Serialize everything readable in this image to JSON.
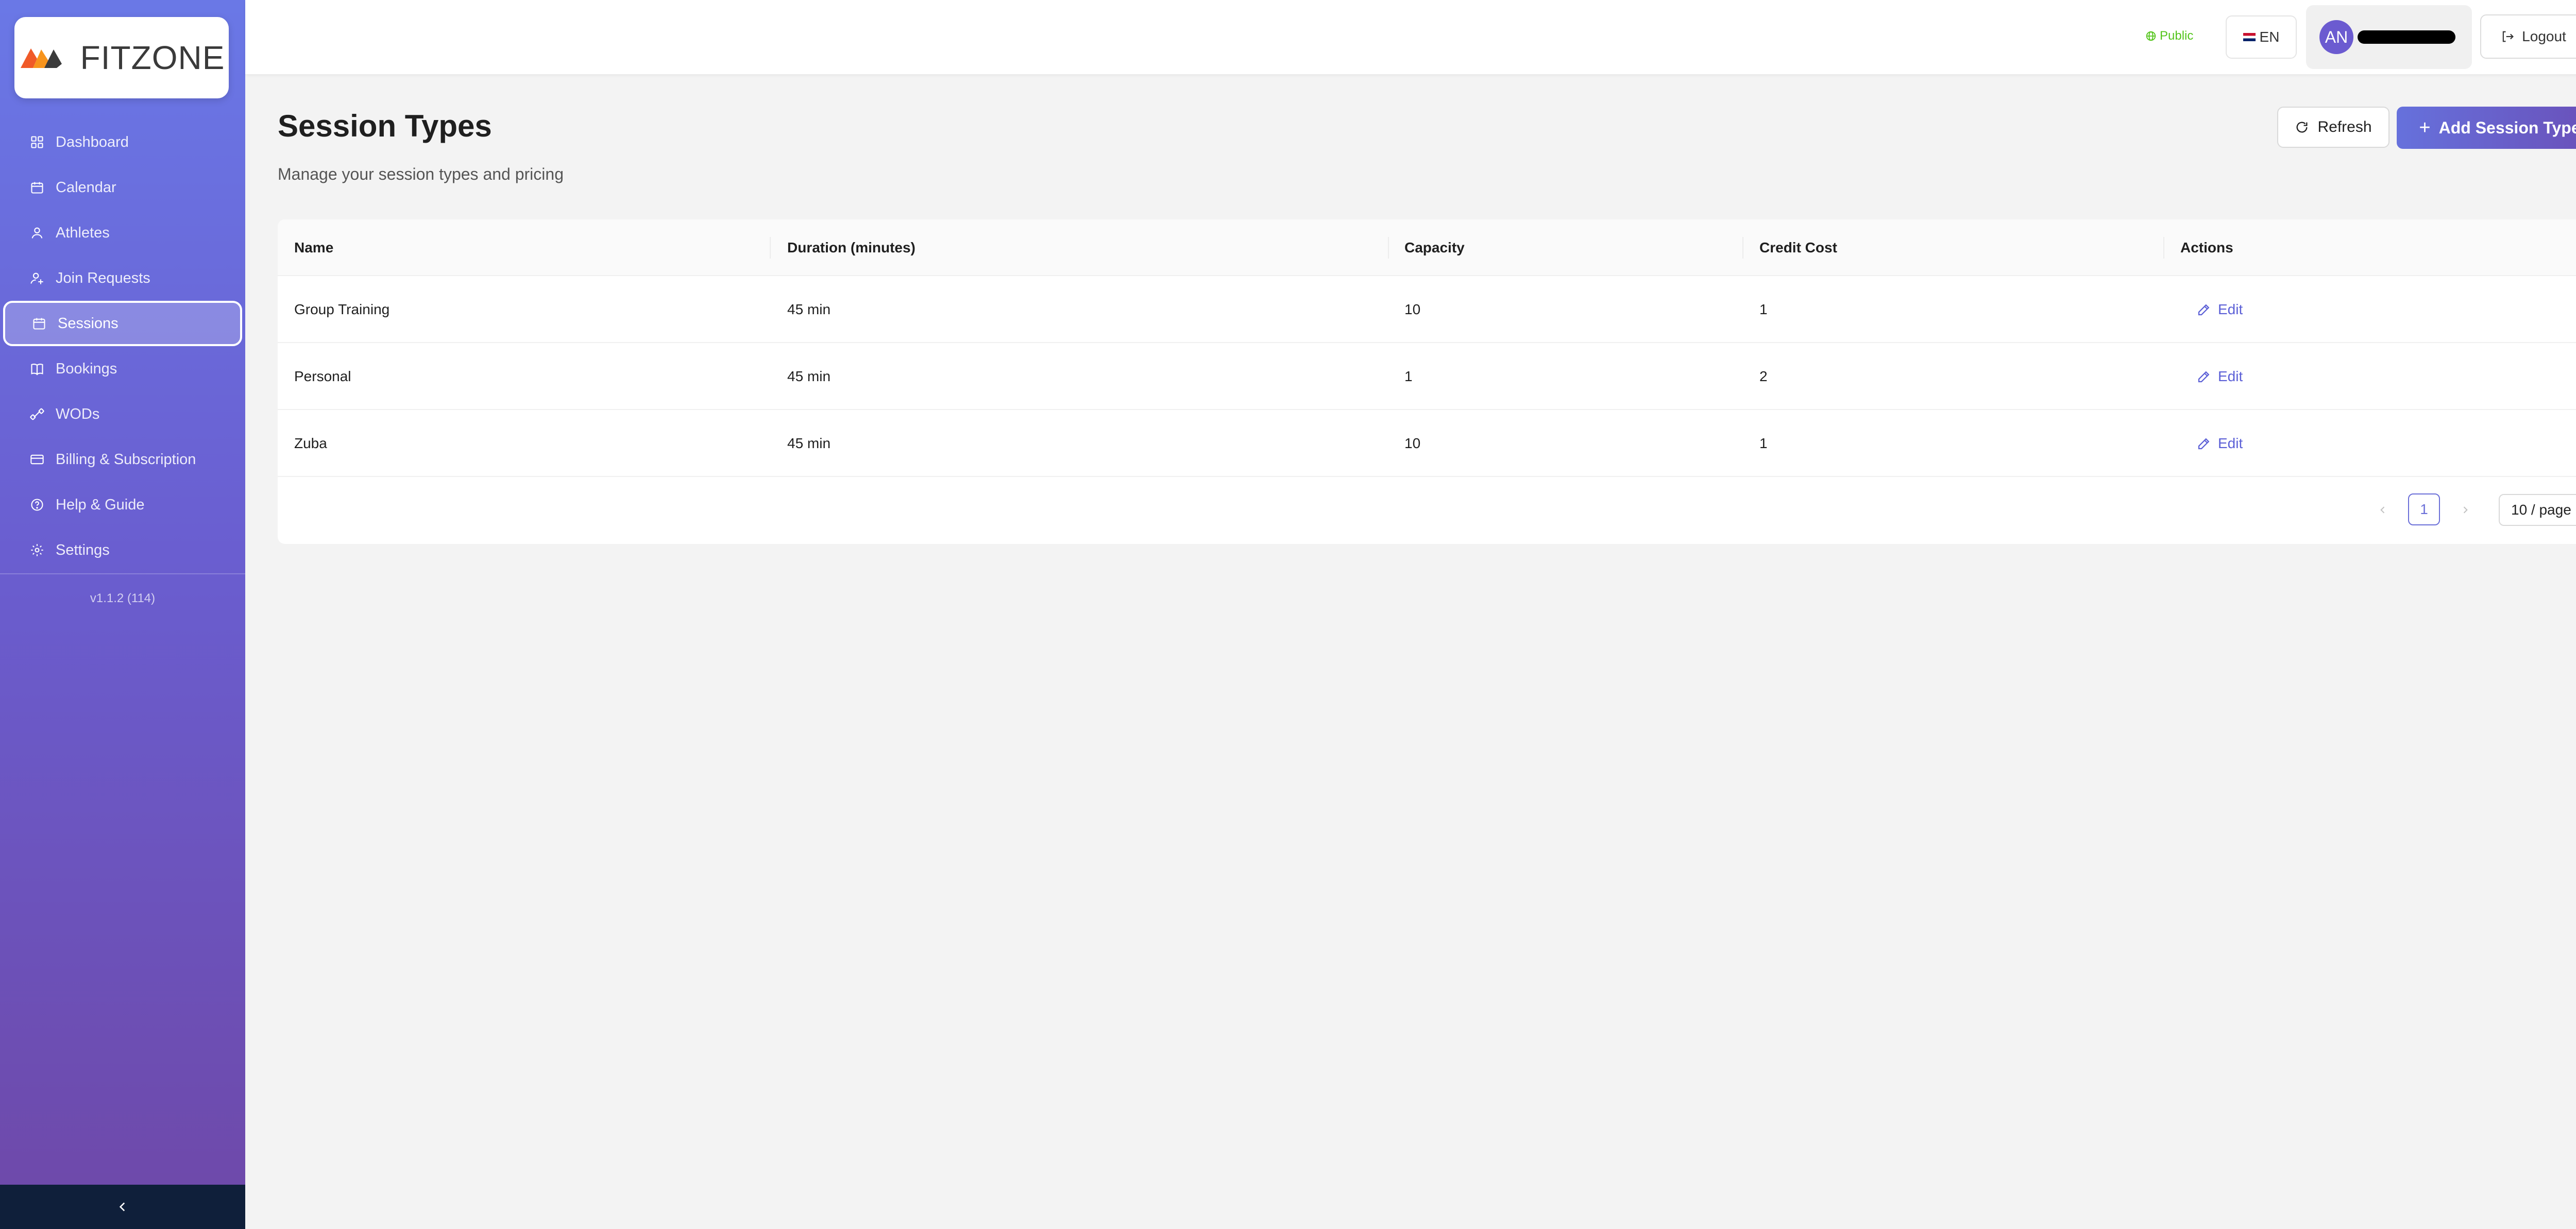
{
  "brand": {
    "logo_text": "FITZONE",
    "colors": {
      "accent": "#6b6fd8",
      "sidebar_top": "#6a78e6",
      "sidebar_bottom": "#6e48a8",
      "public": "#52c41a"
    }
  },
  "sidebar": {
    "items": [
      {
        "label": "Dashboard",
        "icon": "dashboard-icon",
        "active": false
      },
      {
        "label": "Calendar",
        "icon": "calendar-icon",
        "active": false
      },
      {
        "label": "Athletes",
        "icon": "user-icon",
        "active": false
      },
      {
        "label": "Join Requests",
        "icon": "user-add-icon",
        "active": false
      },
      {
        "label": "Sessions",
        "icon": "calendar-icon",
        "active": true
      },
      {
        "label": "Bookings",
        "icon": "book-icon",
        "active": false
      },
      {
        "label": "WODs",
        "icon": "dumbbell-icon",
        "active": false
      },
      {
        "label": "Billing & Subscription",
        "icon": "credit-card-icon",
        "active": false
      },
      {
        "label": "Help & Guide",
        "icon": "question-icon",
        "active": false
      },
      {
        "label": "Settings",
        "icon": "gear-icon",
        "active": false
      }
    ],
    "version": "v1.1.2 (114)",
    "collapse_icon": "chevron-left-icon"
  },
  "header": {
    "public_label": "Public",
    "language_label": "EN",
    "avatar_initials": "AN",
    "logout_label": "Logout"
  },
  "page": {
    "title": "Session Types",
    "subtitle": "Manage your session types and pricing",
    "refresh_label": "Refresh",
    "add_label": "Add Session Type"
  },
  "table": {
    "columns": [
      "Name",
      "Duration (minutes)",
      "Capacity",
      "Credit Cost",
      "Actions"
    ],
    "rows": [
      {
        "name": "Group Training",
        "duration": "45 min",
        "capacity": "10",
        "credit_cost": "1",
        "action": "Edit"
      },
      {
        "name": "Personal",
        "duration": "45 min",
        "capacity": "1",
        "credit_cost": "2",
        "action": "Edit"
      },
      {
        "name": "Zuba",
        "duration": "45 min",
        "capacity": "10",
        "credit_cost": "1",
        "action": "Edit"
      }
    ]
  },
  "pagination": {
    "current_page": "1",
    "page_size_label": "10 / page"
  }
}
